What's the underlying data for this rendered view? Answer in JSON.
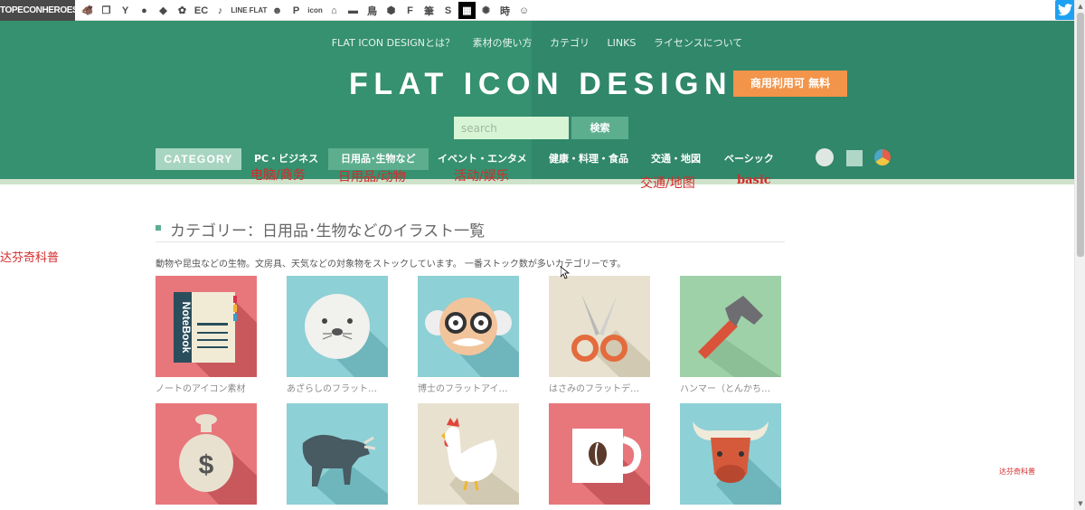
{
  "topbar": {
    "brand": "TOPECONHEROES",
    "icons": [
      {
        "name": "pig-icon",
        "glyph": "🐗"
      },
      {
        "name": "copy-icon",
        "glyph": "❐"
      },
      {
        "name": "figure-icon",
        "glyph": "Y"
      },
      {
        "name": "speech-bubble-icon",
        "glyph": "●"
      },
      {
        "name": "label-icon",
        "glyph": "◆"
      },
      {
        "name": "flower-icon",
        "glyph": "✿"
      },
      {
        "name": "ec-icon",
        "glyph": "EC"
      },
      {
        "name": "music-note-icon",
        "glyph": "♪"
      },
      {
        "name": "line-icon",
        "glyph": "LINE"
      },
      {
        "name": "flat-icon",
        "glyph": "FLAT"
      },
      {
        "name": "smiley-icon",
        "glyph": "☻"
      },
      {
        "name": "parking-icon",
        "glyph": "P"
      },
      {
        "name": "icon-text-icon",
        "glyph": "icon"
      },
      {
        "name": "house-icon",
        "glyph": "⌂"
      },
      {
        "name": "sofa-icon",
        "glyph": "▬"
      },
      {
        "name": "bird-icon",
        "glyph": "鳥"
      },
      {
        "name": "gear-shape-icon",
        "glyph": "⬢"
      },
      {
        "name": "f-letter-icon",
        "glyph": "F"
      },
      {
        "name": "brush-kanji-icon",
        "glyph": "筆"
      },
      {
        "name": "s-letter-icon",
        "glyph": "S"
      },
      {
        "name": "grid-icon",
        "glyph": "▦"
      },
      {
        "name": "burst-icon",
        "glyph": "✺"
      },
      {
        "name": "time-kanji-icon",
        "glyph": "時"
      },
      {
        "name": "face-icon",
        "glyph": "☺"
      }
    ]
  },
  "header": {
    "top_nav": [
      "FLAT ICON DESIGNとは？",
      "素材の使い方",
      "カテゴリ",
      "LINKS",
      "ライセンスについて"
    ],
    "site_title": "FLAT ICON DESIGN",
    "license_badge": "商用利用可 無料",
    "search_placeholder": "search",
    "search_button": "検索",
    "category_button": "CATEGORY",
    "categories": [
      {
        "label": "PC・ビジネス",
        "annotation": "电脑/商务"
      },
      {
        "label": "日用品･生物など",
        "annotation": "日用品/动物",
        "active": true
      },
      {
        "label": "イベント・エンタメ",
        "annotation": "活动/娱乐"
      },
      {
        "label": "健康・料理・食品"
      },
      {
        "label": "交通・地図",
        "annotation": "交通/地图"
      },
      {
        "label": "ベーシック",
        "annotation": "basic"
      }
    ]
  },
  "annotations": {
    "left_note": "达芬奇科普",
    "watermark": "达芬奇科普"
  },
  "content": {
    "title": "カテゴリー：日用品･生物などのイラスト一覧",
    "description": "動物や昆虫などの生物。文房具、天気などの対象物をストックしています。 一番ストック数が多いカテゴリーです。",
    "row1_captions": [
      "ノートのアイコン素材",
      "あざらしのフラット…",
      "博士のフラットアイ…",
      "はさみのフラットデ…",
      "ハンマー（とんかち…"
    ],
    "tile_texts": {
      "notebook": "NoteBook",
      "money": "$"
    }
  },
  "colors": {
    "header_green": "#35916f",
    "accent_orange": "#f29449",
    "search_bg": "#d7f4d4",
    "annotation_red": "#d42a2a"
  }
}
